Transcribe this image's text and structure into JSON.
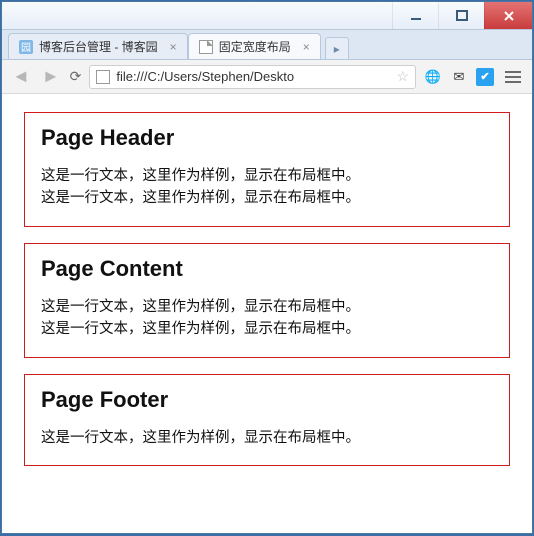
{
  "window": {
    "tabs": [
      {
        "title": "博客后台管理 - 博客园",
        "active": false
      },
      {
        "title": "固定宽度布局",
        "active": true
      }
    ]
  },
  "toolbar": {
    "url": "file:///C:/Users/Stephen/Deskto"
  },
  "page": {
    "sections": [
      {
        "heading": "Page Header",
        "lines": [
          "这是一行文本，这里作为样例，显示在布局框中。",
          "这是一行文本，这里作为样例，显示在布局框中。"
        ]
      },
      {
        "heading": "Page Content",
        "lines": [
          "这是一行文本，这里作为样例，显示在布局框中。",
          "这是一行文本，这里作为样例，显示在布局框中。"
        ]
      },
      {
        "heading": "Page Footer",
        "lines": [
          "这是一行文本，这里作为样例，显示在布局框中。"
        ]
      }
    ]
  }
}
